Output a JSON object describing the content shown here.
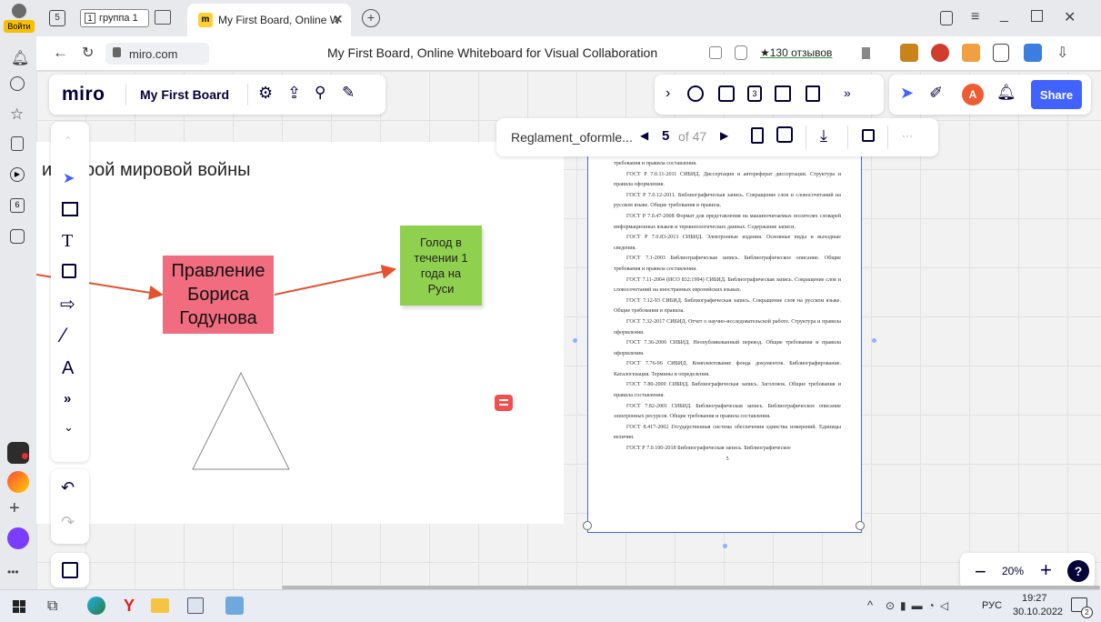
{
  "browser": {
    "profile_label": "Войти",
    "tab_count": "5",
    "group_label": "группа 1",
    "tab_title": "My First Board, Online W",
    "url": "miro.com",
    "page_title": "My First Board, Online Whiteboard for Visual Collaboration",
    "reviews": "★130 отзывов"
  },
  "miro": {
    "logo": "miro",
    "board_name": "My First Board",
    "share_label": "Share",
    "avatar_letter": "A",
    "zoom": "20%",
    "help": "?"
  },
  "doc_toolbar": {
    "filename": "Reglament_oformle...",
    "page": "5",
    "of_label": "of 47",
    "more": "···"
  },
  "board": {
    "frame_title": "и второй мировой войны",
    "sticky_red": "Правление Бориса Годунова",
    "sticky_green": "Голод в течении 1 года на Руси"
  },
  "document": {
    "lines": [
      "требования и правила составления.",
      "ГОСТ Р 7.0.11-2011 СИБИД. Диссертация и автореферат диссертации. Структура и правила оформления.",
      "ГОСТ Р 7.0.12-2011. Библиографическая запись. Сокращение слов и словосочетаний на русском языке. Общие требования и правила.",
      "ГОСТ Р 7.0.47-2008 Формат для представления на машиночитаемых носителях словарей информационных языков и терминологических данных. Содержание записи.",
      "ГОСТ Р 7.0.83-2013 СИБИД. Электронные издания. Основные виды и выходные сведения.",
      "ГОСТ 7.1-2003 Библиографическая запись. Библиографическое описание. Общие требования и правила составления.",
      "ГОСТ 7.11-2004 (ИСО 832:1994) СИБИД. Библиографическая запись. Сокращение слов и словосочетаний на иностранных европейских языках.",
      "ГОСТ 7.12-93 СИБИД. Библиографическая запись. Сокращение слов на русском языке. Общие требования и правила.",
      "ГОСТ 7.32-2017 СИБИД. Отчет о научно-исследовательской работе. Структура и правила оформления.",
      "ГОСТ 7.36-2006 СИБИД. Неопубликованный перевод. Общие требования и правила оформления.",
      "ГОСТ 7.76-96 СИБИД. Комплектование фонда документов. Библиографирование. Каталогизация. Термины и определения.",
      "ГОСТ 7.80-2000 СИБИД. Библиографическая запись. Заголовок. Общие требования и правила составления.",
      "ГОСТ 7.82-2001 СИБИД. Библиографическая запись. Библиографическое описание электронных ресурсов. Общие требования и правила составления.",
      "ГОСТ 8.417-2002 Государственная система обеспечения единства измерений. Единицы величин.",
      "ГОСТ Р 7.0.100-2018 Библиографическая запись. Библиографическое"
    ],
    "page_number": "5"
  },
  "taskbar": {
    "lang": "РУС",
    "time": "19:27",
    "date": "30.10.2022",
    "notif": "2"
  },
  "colors": {
    "accent": "#4262ff",
    "sticky_red": "#f16c7f",
    "sticky_green": "#8fd14f",
    "arrow": "#e6512e"
  }
}
